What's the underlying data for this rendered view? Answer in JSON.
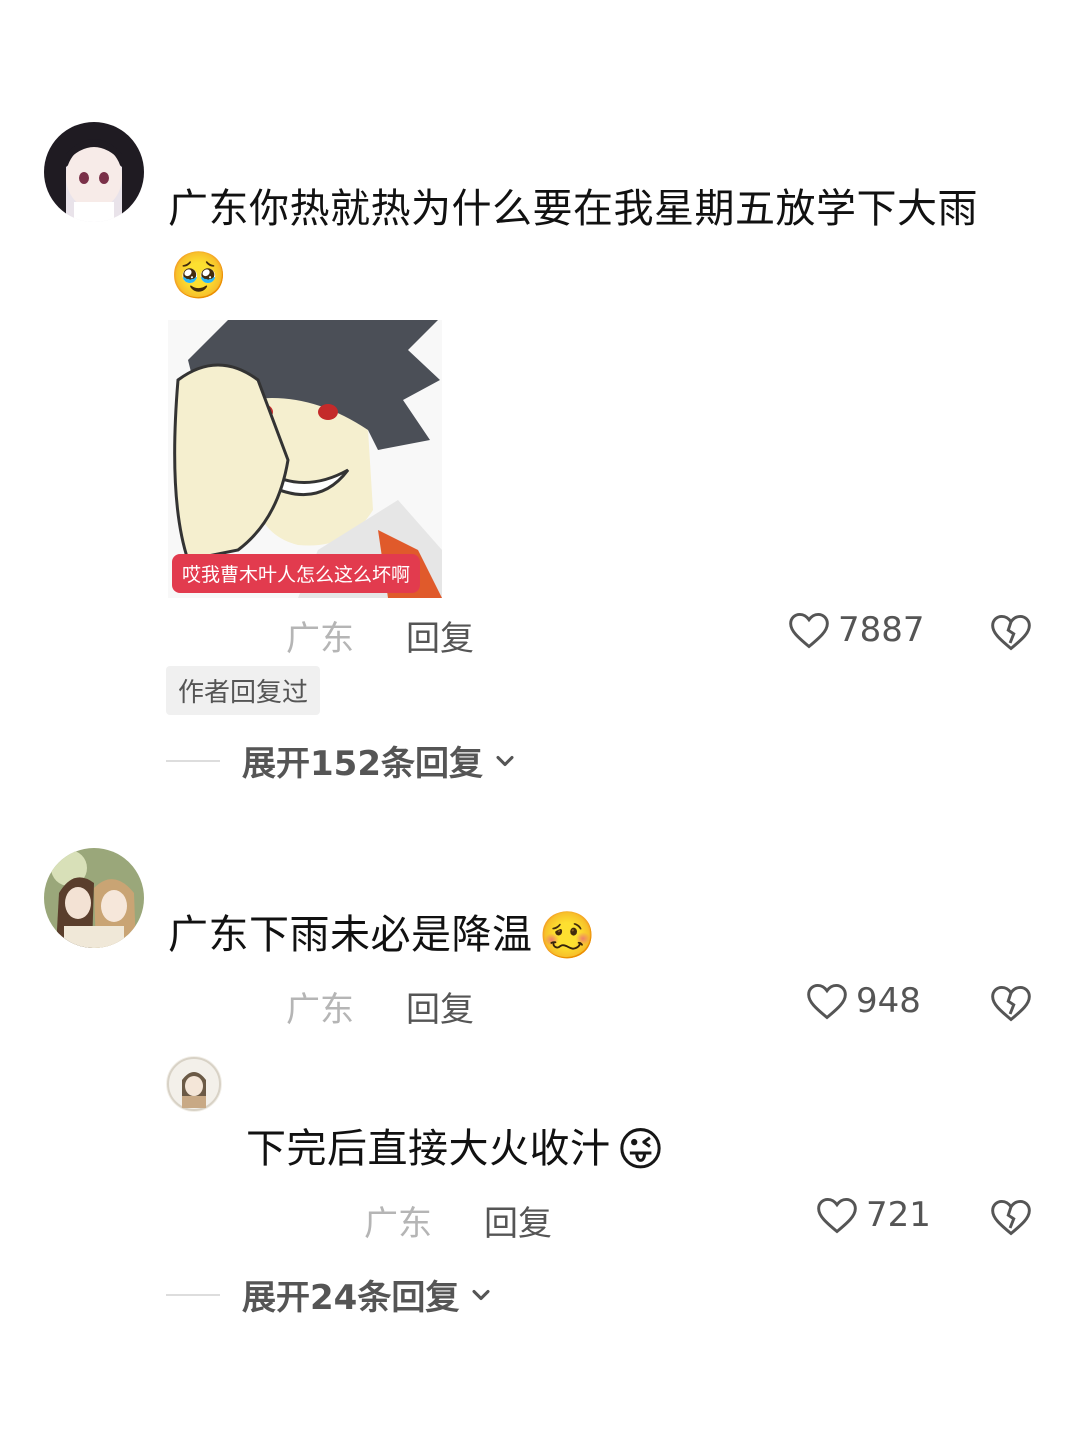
{
  "comments": [
    {
      "text": "广东你热就热为什么要在我星期五放学下大雨",
      "emoji": "🥹",
      "meme_caption": "哎我曹木叶人怎么这么坏啊",
      "location": "广东",
      "reply_label": "回复",
      "likes": "7887",
      "author_badge": "作者回复过",
      "expand_label": "展开152条回复"
    },
    {
      "text": "广东下雨未必是降温",
      "emoji": "🥴",
      "location": "广东",
      "reply_label": "回复",
      "likes": "948",
      "reply": {
        "text": "下完后直接大火收汁",
        "emoji": "😜",
        "location": "广东",
        "reply_label": "回复",
        "likes": "721"
      },
      "expand_label": "展开24条回复"
    }
  ],
  "icons": {
    "like": "heart-outline-icon",
    "dislike": "broken-heart-icon",
    "expand": "chevron-down-icon"
  },
  "colors": {
    "primary_text": "#111111",
    "secondary_text": "#555555",
    "location_text": "#b5b5b5",
    "badge_bg": "#f0f0f0",
    "meme_caption_bg": "#e23b4e"
  }
}
